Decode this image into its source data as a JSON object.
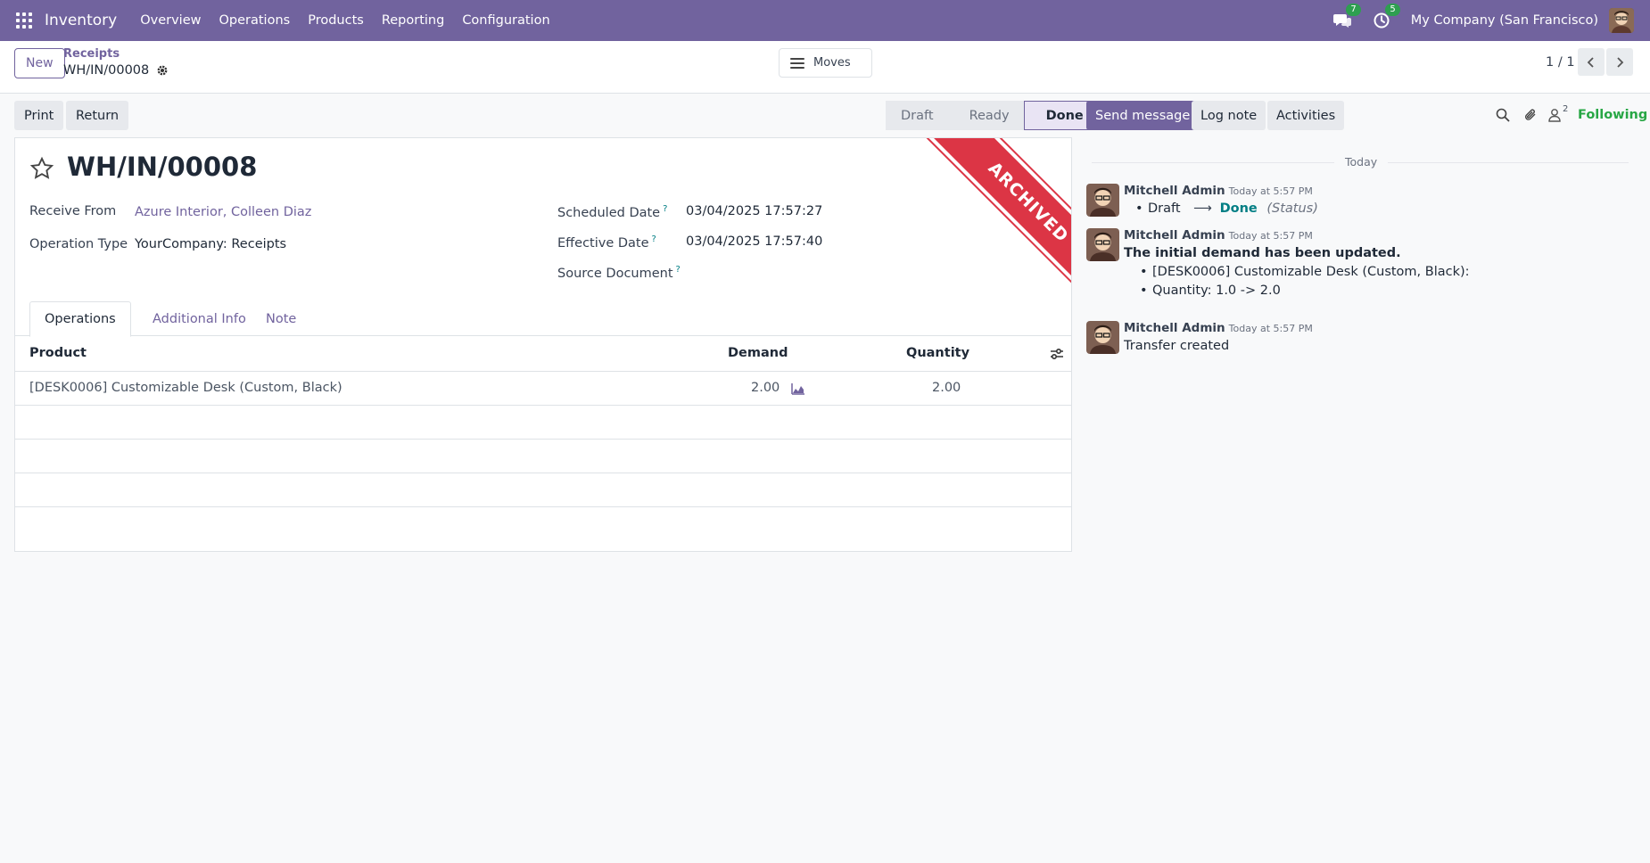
{
  "navbar": {
    "app_name": "Inventory",
    "menu": [
      "Overview",
      "Operations",
      "Products",
      "Reporting",
      "Configuration"
    ],
    "messages_badge": "7",
    "activities_badge": "5",
    "company": "My Company (San Francisco)"
  },
  "control_panel": {
    "new_label": "New",
    "breadcrumb_parent": "Receipts",
    "breadcrumb_current": "WH/IN/00008",
    "moves_label": "Moves",
    "pager": "1 / 1"
  },
  "form_buttons": {
    "print": "Print",
    "return": "Return"
  },
  "statusbar": {
    "steps": [
      "Draft",
      "Ready",
      "Done"
    ],
    "active": "Done"
  },
  "record": {
    "title": "WH/IN/00008",
    "ribbon": "ARCHIVED",
    "receive_from_label": "Receive From",
    "receive_from_value": "Azure Interior, Colleen Diaz",
    "operation_type_label": "Operation Type",
    "operation_type_value": "YourCompany: Receipts",
    "scheduled_date_label": "Scheduled Date",
    "scheduled_date_value": "03/04/2025 17:57:27",
    "effective_date_label": "Effective Date",
    "effective_date_value": "03/04/2025 17:57:40",
    "source_document_label": "Source Document",
    "help_mark": "?"
  },
  "tabs": [
    "Operations",
    "Additional Info",
    "Note"
  ],
  "table": {
    "headers": {
      "product": "Product",
      "demand": "Demand",
      "quantity": "Quantity"
    },
    "rows": [
      {
        "product": "[DESK0006] Customizable Desk (Custom, Black)",
        "demand": "2.00",
        "quantity": "2.00"
      }
    ]
  },
  "chatter": {
    "send_message": "Send message",
    "log_note": "Log note",
    "activities": "Activities",
    "followers_count": "2",
    "following": "Following",
    "date_separator": "Today",
    "messages": [
      {
        "author": "Mitchell Admin",
        "date": "Today at 5:57 PM",
        "tracking_old": "Draft",
        "tracking_new": "Done",
        "tracking_field": "(Status)"
      },
      {
        "author": "Mitchell Admin",
        "date": "Today at 5:57 PM",
        "body": "The initial demand has been updated.",
        "items": [
          "[DESK0006] Customizable Desk (Custom, Black):",
          "Quantity: 1.0 -> 2.0"
        ]
      },
      {
        "author": "Mitchell Admin",
        "date": "Today at 5:57 PM",
        "body": "Transfer created"
      }
    ]
  },
  "colors": {
    "brand": "#71639e",
    "ribbon": "#dc3545",
    "following": "#28a745",
    "badge": "#2e9f50"
  }
}
